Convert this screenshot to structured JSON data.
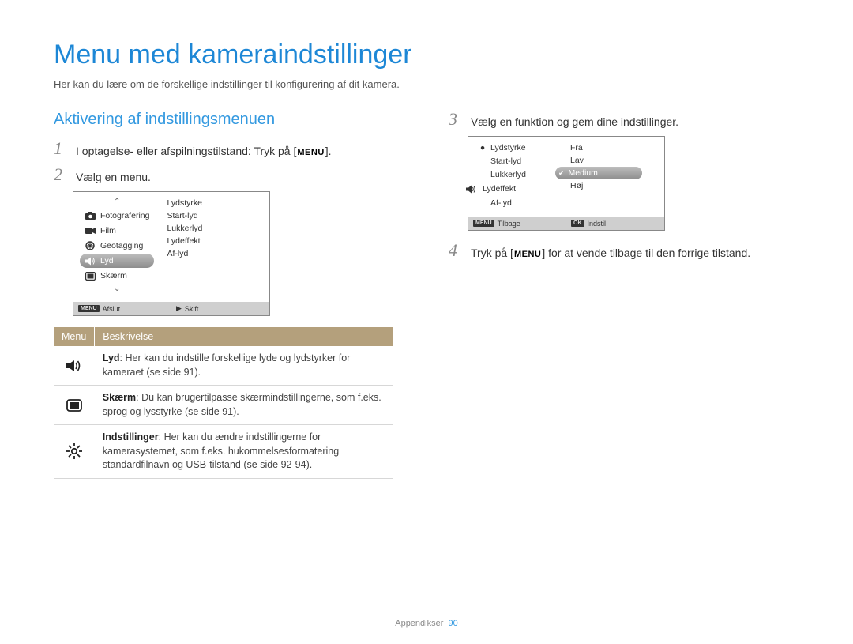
{
  "title": "Menu med kameraindstillinger",
  "subtitle": "Her kan du lære om de forskellige indstillinger til konfigurering af dit kamera.",
  "section_heading": "Aktivering af indstillingsmenuen",
  "menu_tag": "MENU",
  "steps": {
    "s1": {
      "num": "1",
      "text_before": "I optagelse- eller afspilningstilstand: Tryk på [",
      "text_after": "]."
    },
    "s2": {
      "num": "2",
      "text": "Vælg en menu."
    },
    "s3": {
      "num": "3",
      "text": "Vælg en funktion og gem dine indstillinger."
    },
    "s4": {
      "num": "4",
      "text_before": "Tryk på [",
      "text_after": "] for at vende tilbage til den forrige tilstand."
    }
  },
  "screen1": {
    "left": [
      {
        "icon": "camera",
        "label": "Fotografering"
      },
      {
        "icon": "film",
        "label": "Film"
      },
      {
        "icon": "globe",
        "label": "Geotagging"
      },
      {
        "icon": "sound",
        "label": "Lyd",
        "selected": true
      },
      {
        "icon": "screen",
        "label": "Skærm"
      }
    ],
    "right": [
      {
        "label": "Lydstyrke"
      },
      {
        "label": "Start-lyd"
      },
      {
        "label": "Lukkerlyd"
      },
      {
        "label": "Lydeffekt"
      },
      {
        "label": "Af-lyd"
      }
    ],
    "footer_left_tag": "MENU",
    "footer_left": "Afslut",
    "footer_right_icon": "▶",
    "footer_right": "Skift"
  },
  "screen2": {
    "left_icon": "sound",
    "left": [
      {
        "label": "Lydstyrke",
        "bullet": true
      },
      {
        "label": "Start-lyd"
      },
      {
        "label": "Lukkerlyd"
      },
      {
        "label": "Lydeffekt"
      },
      {
        "label": "Af-lyd"
      }
    ],
    "right": [
      {
        "label": "Fra"
      },
      {
        "label": "Lav"
      },
      {
        "label": "Medium",
        "selected": true,
        "check": true
      },
      {
        "label": "Høj"
      }
    ],
    "footer_left_tag": "MENU",
    "footer_left": "Tilbage",
    "footer_right_tag": "OK",
    "footer_right": "Indstil"
  },
  "table": {
    "head_menu": "Menu",
    "head_desc": "Beskrivelse",
    "rows": [
      {
        "icon": "sound",
        "bold": "Lyd",
        "text": ": Her kan du indstille forskellige lyde og lydstyrker for kameraet (se side 91)."
      },
      {
        "icon": "screen",
        "bold": "Skærm",
        "text": ": Du kan brugertilpasse skærmindstillingerne, som f.eks. sprog og lysstyrke (se side 91)."
      },
      {
        "icon": "gear",
        "bold": "Indstillinger",
        "text": ": Her kan du ændre indstillingerne for kamerasystemet, som f.eks. hukommelsesformatering standardfilnavn og USB-tilstand (se side 92-94)."
      }
    ]
  },
  "footer": {
    "label": "Appendikser",
    "page": "90"
  }
}
